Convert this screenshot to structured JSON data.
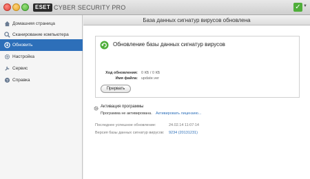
{
  "titlebar": {
    "logo": "ESET",
    "product": "CYBER SECURITY PRO"
  },
  "sidebar": {
    "items": [
      {
        "label": "Домашняя страница",
        "icon": "home-icon"
      },
      {
        "label": "Сканирование компьютера",
        "icon": "scan-icon"
      },
      {
        "label": "Обновить",
        "icon": "update-icon",
        "active": true
      },
      {
        "label": "Настройка",
        "icon": "gear-icon"
      },
      {
        "label": "Сервис",
        "icon": "tools-icon"
      },
      {
        "label": "Справка",
        "icon": "help-icon"
      }
    ]
  },
  "header": {
    "title": "База данных сигнатур вирусов обновлена"
  },
  "update": {
    "title": "Обновление базы данных сигнатур вирусов",
    "progress_label": "Ход обновления:",
    "progress_value": "0 КБ / 0 КБ",
    "filename_label": "Имя файла:",
    "filename_value": "update.ver",
    "stop_label": "Прервать"
  },
  "activation": {
    "title": "Активация программы",
    "status": "Программа не активирована.",
    "link": "Активировать лицензию..."
  },
  "info": {
    "last_update_label": "Последнее успешное обновление:",
    "last_update_value": "24.02.14 11:07:14",
    "db_version_label": "Версия базы данных сигнатур вирусов:",
    "db_version_value": "9234 (20131231)"
  },
  "colors": {
    "accent": "#2d6fb9",
    "status_ok": "#4fae3a"
  }
}
